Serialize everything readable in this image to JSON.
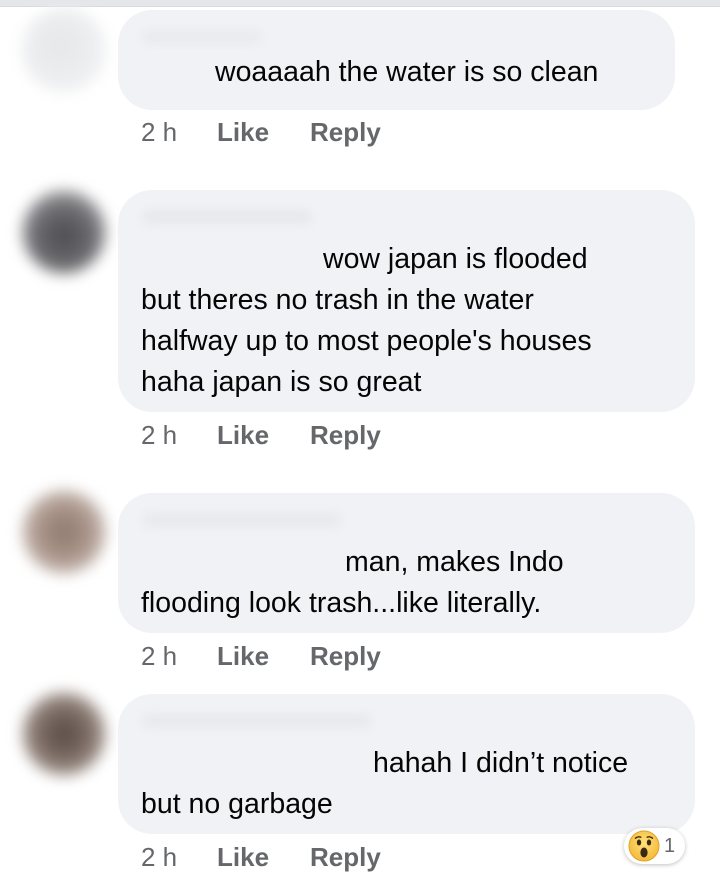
{
  "comments": [
    {
      "lines": [
        "woaaaah the water is so clean"
      ],
      "time": "2 h",
      "like_label": "Like",
      "reply_label": "Reply"
    },
    {
      "lines": [
        "wow japan is flooded",
        "but theres no trash in the water",
        "halfway up to most people's houses",
        "haha japan is so great"
      ],
      "time": "2 h",
      "like_label": "Like",
      "reply_label": "Reply"
    },
    {
      "lines": [
        "man, makes Indo",
        "flooding look trash...like literally."
      ],
      "time": "2 h",
      "like_label": "Like",
      "reply_label": "Reply"
    },
    {
      "lines": [
        "hahah I didn’t notice",
        "but no garbage"
      ],
      "time": "2 h",
      "like_label": "Like",
      "reply_label": "Reply",
      "reaction": {
        "icon": "wow-emoji-icon",
        "count": "1"
      }
    }
  ],
  "colors": {
    "bubble": "#f0f2f5",
    "action_text": "#65676b",
    "comment_text": "#050505"
  }
}
